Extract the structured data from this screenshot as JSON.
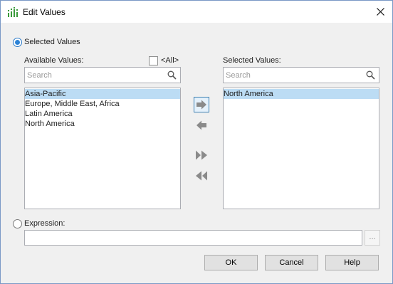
{
  "window": {
    "title": "Edit Values",
    "close_icon": "close-icon",
    "app_icon": "bar-chart-icon"
  },
  "mode": {
    "selected_values_label": "Selected Values",
    "selected_values_checked": true,
    "expression_label": "Expression:",
    "expression_checked": false
  },
  "available": {
    "label": "Available Values:",
    "all_label": "<All>",
    "all_checked": false,
    "search_placeholder": "Search",
    "items": [
      "Asia-Pacific",
      "Europe, Middle East, Africa",
      "Latin America",
      "North America"
    ],
    "selected_index": 0
  },
  "selected": {
    "label": "Selected Values:",
    "search_placeholder": "Search",
    "items": [
      "North America"
    ],
    "selected_index": 0
  },
  "transfer": {
    "add_icon": "arrow-right-icon",
    "remove_icon": "arrow-left-icon",
    "add_all_icon": "double-arrow-right-icon",
    "remove_all_icon": "double-arrow-left-icon"
  },
  "expression": {
    "value": "",
    "browse_label": "..."
  },
  "buttons": {
    "ok": "OK",
    "cancel": "Cancel",
    "help": "Help"
  },
  "colors": {
    "selection": "#bcdcf4",
    "radio_accent": "#2d83d6",
    "icon_green": "#3a9a3a"
  }
}
